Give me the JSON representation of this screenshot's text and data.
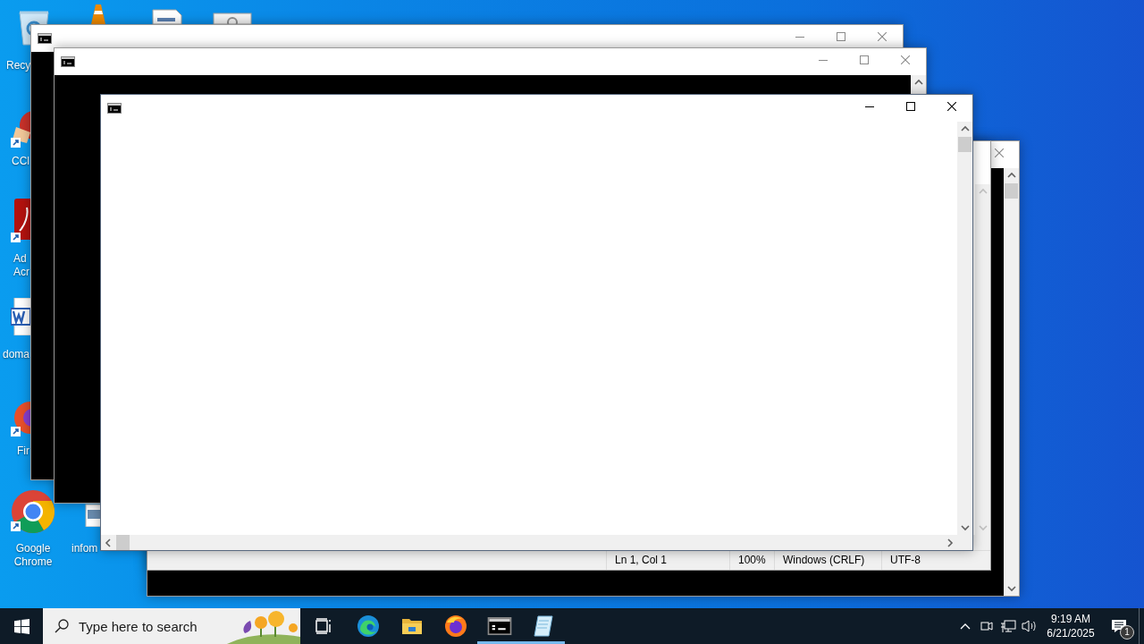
{
  "desktop": {
    "icons": [
      {
        "kind": "recycle",
        "label": "Recy"
      },
      {
        "kind": "cone"
      },
      {
        "kind": "document"
      },
      {
        "kind": "settings"
      },
      {
        "kind": "cleaner",
        "label": "CCl"
      },
      {
        "kind": "pdf",
        "label": "Ad\nAcr"
      },
      {
        "kind": "word",
        "label": "doma"
      },
      {
        "kind": "firefox",
        "label": "Fir"
      },
      {
        "kind": "chrome",
        "label": "Google Chrome"
      },
      {
        "kind": "image",
        "label": "infom"
      }
    ]
  },
  "windows": [
    {
      "kind": "console",
      "active": false
    },
    {
      "kind": "notepad",
      "active": false,
      "status_bar": [
        "Ln 1, Col 1",
        "100%",
        "Windows (CRLF)",
        "UTF-8"
      ]
    },
    {
      "kind": "console",
      "active": false
    },
    {
      "kind": "console",
      "active": false
    },
    {
      "kind": "text",
      "active": true
    }
  ],
  "taskbar": {
    "search": {
      "placeholder": "Type here to search"
    },
    "apps": [
      {
        "kind": "taskview",
        "running": false
      },
      {
        "kind": "edge",
        "running": false
      },
      {
        "kind": "explorer",
        "running": false
      },
      {
        "kind": "firefox",
        "running": false
      },
      {
        "kind": "console",
        "running": true
      },
      {
        "kind": "notepad",
        "running": true
      }
    ],
    "tray": {
      "time": "9:19 AM",
      "date": "6/21/2025",
      "notifications": "1"
    }
  }
}
